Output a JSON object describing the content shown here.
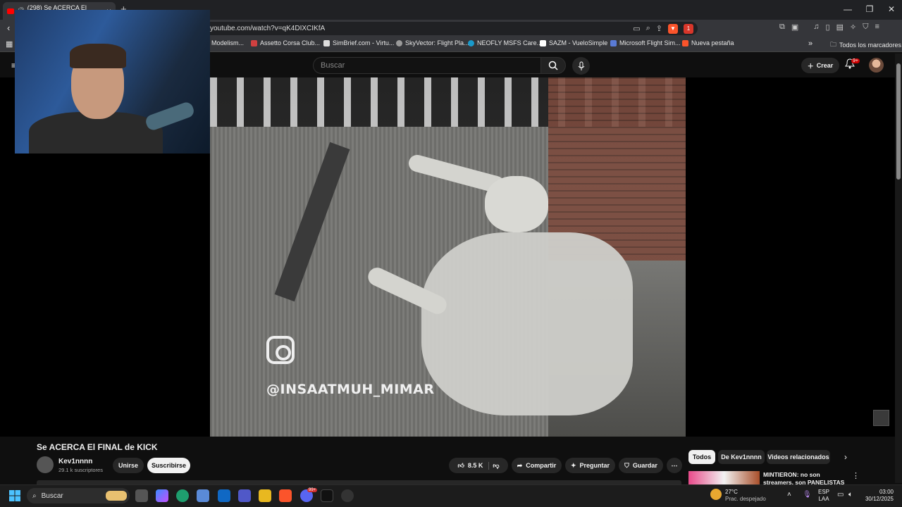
{
  "browser": {
    "tab_title": "(298) Se ACERCA El FINAL de",
    "new_tab": "+",
    "url": "youtube.com/watch?v=qK4DIXCIKfA",
    "shield_count": "1",
    "bookmarks": [
      {
        "label": "Modelism...",
        "color": "#c03030"
      },
      {
        "label": "Assetto Corsa Club...",
        "color": "#d04040"
      },
      {
        "label": "SimBrief.com - Virtu...",
        "color": "#dddddd"
      },
      {
        "label": "SkyVector: Flight Pla...",
        "color": "#9a9a9a"
      },
      {
        "label": "NEOFLY MSFS Care...",
        "color": "#1a9acb"
      },
      {
        "label": "SAZM - VueloSimple",
        "color": "#ffffff"
      },
      {
        "label": "Microsoft Flight Sim...",
        "color": "#5a7bd6"
      },
      {
        "label": "Nueva pestaña",
        "color": "#fb542b"
      }
    ],
    "all_bookmarks": "Todos los marcadores"
  },
  "youtube": {
    "search_placeholder": "Buscar",
    "create_label": "Crear",
    "notif_badge": "9+",
    "video_title": "Se ACERCA El FINAL de KICK",
    "channel_name": "Kev1nnnn",
    "subscribers": "29.1 k suscriptores",
    "join_label": "Unirse",
    "subscribe_label": "Suscribirse",
    "likes": "8.5 K",
    "share_label": "Compartir",
    "ask_label": "Preguntar",
    "save_label": "Guardar",
    "chips": [
      "Todos",
      "De Kev1nnnn",
      "Videos relacionados"
    ],
    "rec_title": "MINTIERON: no son streamers, son PANELISTAS con sponsor"
  },
  "video_overlay": {
    "instagram_handle": "@INSAATMUH_MIMAR"
  },
  "taskbar": {
    "search_label": "Buscar",
    "weather_temp": "27°C",
    "weather_desc": "Prac. despejado",
    "lang_top": "ESP",
    "lang_bottom": "LAA",
    "time": "03:00",
    "date": "30/12/2025",
    "discord_badge": "99+"
  }
}
